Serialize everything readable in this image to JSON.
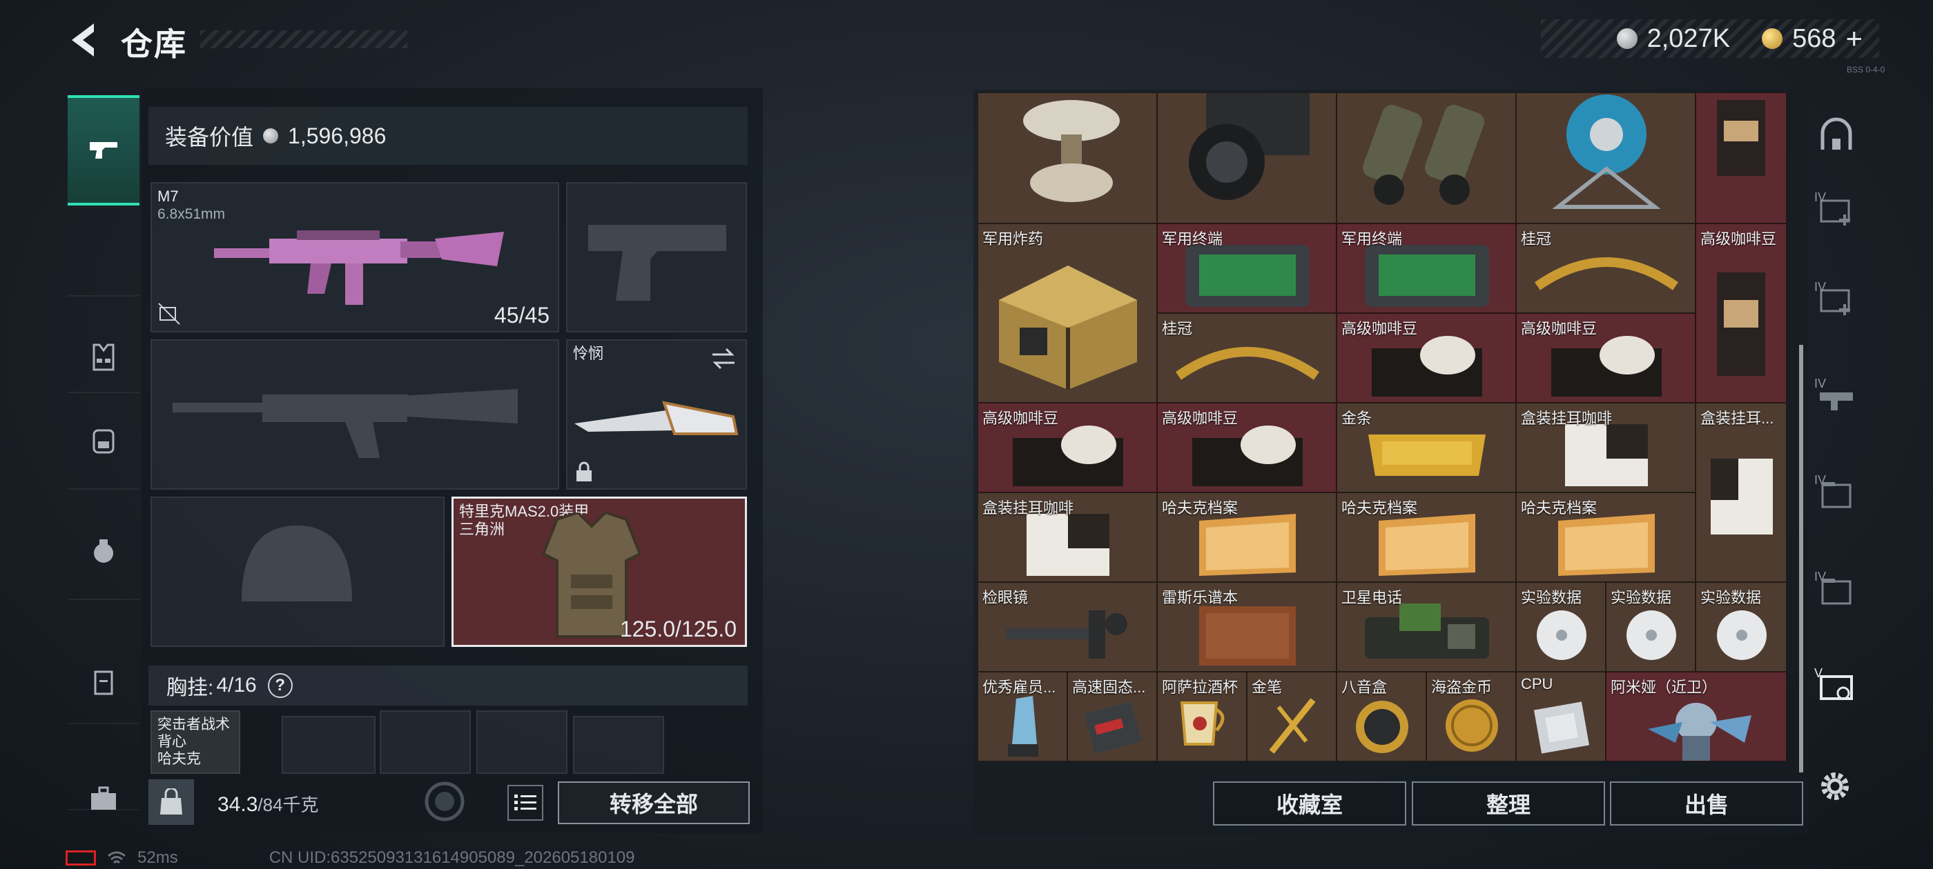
{
  "header": {
    "title": "仓库",
    "currency_silver": "2,027K",
    "currency_gold": "568",
    "plus": "+",
    "version": "BSS 0-4-0"
  },
  "equipment": {
    "value_label": "装备价值",
    "value": "1,596,986",
    "primary_weapon": {
      "name": "M7",
      "caliber": "6.8x51mm",
      "ammo": "45/45"
    },
    "melee": {
      "name": "怜悯"
    },
    "armor": {
      "name": "特里克MAS2.0装甲",
      "sub": "三角洲",
      "durability": "125.0/125.0"
    },
    "chest_rig": {
      "label": "胸挂:",
      "count": "4/16",
      "help": "?",
      "item_name": "突击者战术背心",
      "item_sub": "哈夫克"
    },
    "weight": {
      "current": "34.3",
      "max": "/84千克"
    },
    "transfer_all": "转移全部"
  },
  "grid_items": [
    {
      "label": "军用炸药"
    },
    {
      "label": "军用终端"
    },
    {
      "label": "军用终端"
    },
    {
      "label": "桂冠"
    },
    {
      "label": "高级咖啡豆"
    },
    {
      "label": "桂冠"
    },
    {
      "label": "高级咖啡豆"
    },
    {
      "label": "高级咖啡豆"
    },
    {
      "label": "高级咖啡豆"
    },
    {
      "label": "高级咖啡豆"
    },
    {
      "label": "金条"
    },
    {
      "label": "盒装挂耳咖啡"
    },
    {
      "label": "盒装挂耳..."
    },
    {
      "label": "盒装挂耳咖啡"
    },
    {
      "label": "哈夫克档案"
    },
    {
      "label": "哈夫克档案"
    },
    {
      "label": "哈夫克档案"
    },
    {
      "label": "检眼镜"
    },
    {
      "label": "雷斯乐谱本"
    },
    {
      "label": "卫星电话"
    },
    {
      "label": "实验数据"
    },
    {
      "label": "实验数据"
    },
    {
      "label": "实验数据"
    },
    {
      "label": "优秀雇员..."
    },
    {
      "label": "高速固态..."
    },
    {
      "label": "阿萨拉酒杯"
    },
    {
      "label": "金笔"
    },
    {
      "label": "八音盒"
    },
    {
      "label": "海盗金币"
    },
    {
      "label": "CPU"
    },
    {
      "label": "阿米娅（近卫）"
    }
  ],
  "grid_buttons": {
    "collection": "收藏室",
    "organize": "整理",
    "sell": "出售"
  },
  "status_bar": {
    "ping": "52ms",
    "uid": "CN UID:63525093131614905089_202605180109"
  },
  "colors": {
    "accent": "#2ee0b4",
    "cell_red": "#5d2a30",
    "cell_brown": "#4e3c30"
  }
}
